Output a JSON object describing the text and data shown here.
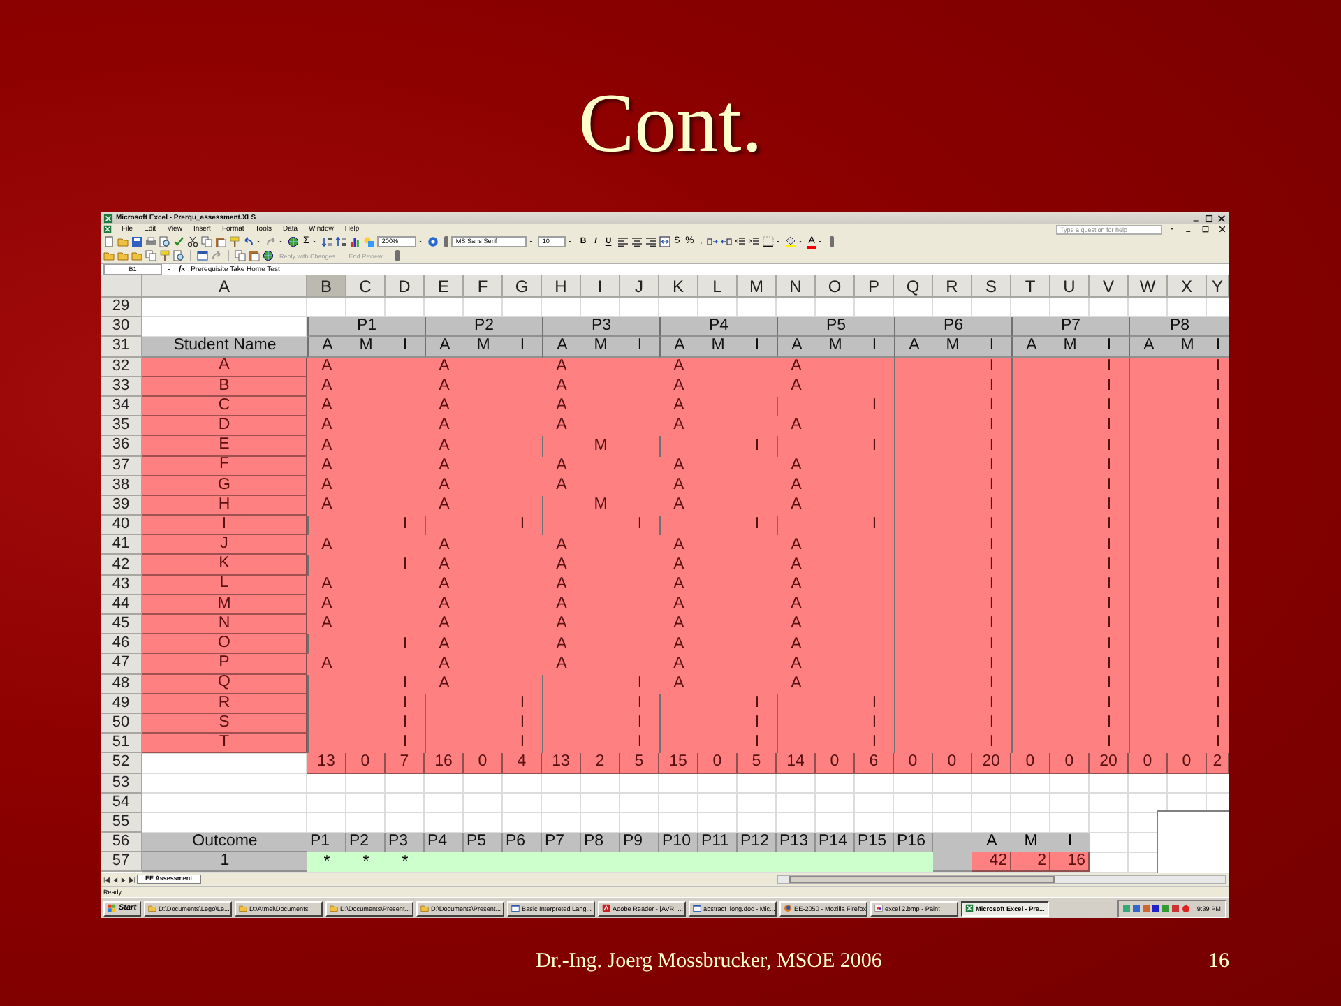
{
  "slide": {
    "title": "Cont.",
    "footer": "Dr.-Ing. Joerg Mossbrucker, MSOE 2006",
    "page_number": "16"
  },
  "excel": {
    "title": "Microsoft Excel - Prerqu_assessment.XLS",
    "menu": [
      "File",
      "Edit",
      "View",
      "Insert",
      "Format",
      "Tools",
      "Data",
      "Window",
      "Help"
    ],
    "help_placeholder": "Type a question for help",
    "toolbar": {
      "autosum": "Σ",
      "zoom": "200%",
      "font": "MS Sans Serif",
      "font_size": "10",
      "format_buttons": [
        "B",
        "I",
        "U"
      ],
      "number_buttons": [
        "$",
        "%",
        ","
      ],
      "font_color_button": "A",
      "review_buttons": [
        "Reply with Changes...",
        "End Review..."
      ]
    },
    "formula_bar": {
      "name_box": "B1",
      "function_label": "fx",
      "content": "Prerequisite Take Home Test"
    },
    "sheet": {
      "columns": [
        {
          "label": "A",
          "selected": false
        },
        {
          "label": "B",
          "selected": true
        },
        {
          "label": "C",
          "selected": false
        },
        {
          "label": "D",
          "selected": false
        },
        {
          "label": "E",
          "selected": false
        },
        {
          "label": "F",
          "selected": false
        },
        {
          "label": "G",
          "selected": false
        },
        {
          "label": "H",
          "selected": false
        },
        {
          "label": "I",
          "selected": false
        },
        {
          "label": "J",
          "selected": false
        },
        {
          "label": "K",
          "selected": false
        },
        {
          "label": "L",
          "selected": false
        },
        {
          "label": "M",
          "selected": false
        },
        {
          "label": "N",
          "selected": false
        },
        {
          "label": "O",
          "selected": false
        },
        {
          "label": "P",
          "selected": false
        },
        {
          "label": "Q",
          "selected": false
        },
        {
          "label": "R",
          "selected": false
        },
        {
          "label": "S",
          "selected": false
        },
        {
          "label": "T",
          "selected": false
        },
        {
          "label": "U",
          "selected": false
        },
        {
          "label": "V",
          "selected": false
        },
        {
          "label": "W",
          "selected": false
        },
        {
          "label": "X",
          "selected": false
        },
        {
          "label": "Y",
          "selected": false
        }
      ],
      "rows": [
        {
          "number": "29",
          "kind": "blank"
        },
        {
          "number": "30",
          "kind": "group_header",
          "groups": [
            "P1",
            "P2",
            "P3",
            "P4",
            "P5",
            "P6",
            "P7",
            "P8"
          ]
        },
        {
          "number": "31",
          "kind": "sub_header",
          "name": "Student Name",
          "cells": [
            "A",
            "M",
            "I",
            "A",
            "M",
            "I",
            "A",
            "M",
            "I",
            "A",
            "M",
            "I",
            "A",
            "M",
            "I",
            "A",
            "M",
            "I",
            "A",
            "M",
            "I",
            "A",
            "M",
            "I"
          ]
        },
        {
          "number": "32",
          "kind": "student",
          "name": "A",
          "grades": [
            {
              "kind": "a",
              "text": "A"
            },
            {
              "kind": "a",
              "text": "A"
            },
            {
              "kind": "a",
              "text": "A"
            },
            {
              "kind": "a",
              "text": "A"
            },
            {
              "kind": "a",
              "text": "A"
            },
            {
              "kind": "i",
              "text": "I"
            },
            {
              "kind": "i",
              "text": "I"
            },
            {
              "kind": "i",
              "text": "I"
            }
          ]
        },
        {
          "number": "33",
          "kind": "student",
          "name": "B",
          "grades": [
            {
              "kind": "a",
              "text": "A"
            },
            {
              "kind": "a",
              "text": "A"
            },
            {
              "kind": "a",
              "text": "A"
            },
            {
              "kind": "a",
              "text": "A"
            },
            {
              "kind": "a",
              "text": "A"
            },
            {
              "kind": "i",
              "text": "I"
            },
            {
              "kind": "i",
              "text": "I"
            },
            {
              "kind": "i",
              "text": "I"
            }
          ]
        },
        {
          "number": "34",
          "kind": "student",
          "name": "C",
          "grades": [
            {
              "kind": "a",
              "text": "A"
            },
            {
              "kind": "a",
              "text": "A"
            },
            {
              "kind": "a",
              "text": "A"
            },
            {
              "kind": "a",
              "text": "A"
            },
            {
              "kind": "i",
              "text": "I"
            },
            {
              "kind": "i",
              "text": "I"
            },
            {
              "kind": "i",
              "text": "I"
            },
            {
              "kind": "i",
              "text": "I"
            }
          ]
        },
        {
          "number": "35",
          "kind": "student",
          "name": "D",
          "grades": [
            {
              "kind": "a",
              "text": "A"
            },
            {
              "kind": "a",
              "text": "A"
            },
            {
              "kind": "a",
              "text": "A"
            },
            {
              "kind": "a",
              "text": "A"
            },
            {
              "kind": "a",
              "text": "A"
            },
            {
              "kind": "i",
              "text": "I"
            },
            {
              "kind": "i",
              "text": "I"
            },
            {
              "kind": "i",
              "text": "I"
            }
          ]
        },
        {
          "number": "36",
          "kind": "student",
          "name": "E",
          "grades": [
            {
              "kind": "a",
              "text": "A"
            },
            {
              "kind": "a",
              "text": "A"
            },
            {
              "kind": "m",
              "text": "M"
            },
            {
              "kind": "i",
              "text": "I"
            },
            {
              "kind": "i",
              "text": "I"
            },
            {
              "kind": "i",
              "text": "I"
            },
            {
              "kind": "i",
              "text": "I"
            },
            {
              "kind": "i",
              "text": "I"
            }
          ]
        },
        {
          "number": "37",
          "kind": "student",
          "name": "F",
          "grades": [
            {
              "kind": "a",
              "text": "A"
            },
            {
              "kind": "a",
              "text": "A"
            },
            {
              "kind": "a",
              "text": "A"
            },
            {
              "kind": "a",
              "text": "A"
            },
            {
              "kind": "a",
              "text": "A"
            },
            {
              "kind": "i",
              "text": "I"
            },
            {
              "kind": "i",
              "text": "I"
            },
            {
              "kind": "i",
              "text": "I"
            }
          ]
        },
        {
          "number": "38",
          "kind": "student",
          "name": "G",
          "grades": [
            {
              "kind": "a",
              "text": "A"
            },
            {
              "kind": "a",
              "text": "A"
            },
            {
              "kind": "a",
              "text": "A"
            },
            {
              "kind": "a",
              "text": "A"
            },
            {
              "kind": "a",
              "text": "A"
            },
            {
              "kind": "i",
              "text": "I"
            },
            {
              "kind": "i",
              "text": "I"
            },
            {
              "kind": "i",
              "text": "I"
            }
          ]
        },
        {
          "number": "39",
          "kind": "student",
          "name": "H",
          "grades": [
            {
              "kind": "a",
              "text": "A"
            },
            {
              "kind": "a",
              "text": "A"
            },
            {
              "kind": "m",
              "text": "M"
            },
            {
              "kind": "a",
              "text": "A"
            },
            {
              "kind": "a",
              "text": "A"
            },
            {
              "kind": "i",
              "text": "I"
            },
            {
              "kind": "i",
              "text": "I"
            },
            {
              "kind": "i",
              "text": "I"
            }
          ]
        },
        {
          "number": "40",
          "kind": "student",
          "name": "I",
          "grades": [
            {
              "kind": "i",
              "text": "I"
            },
            {
              "kind": "i",
              "text": "I"
            },
            {
              "kind": "i",
              "text": "I"
            },
            {
              "kind": "i",
              "text": "I"
            },
            {
              "kind": "i",
              "text": "I"
            },
            {
              "kind": "i",
              "text": "I"
            },
            {
              "kind": "i",
              "text": "I"
            },
            {
              "kind": "i",
              "text": "I"
            }
          ]
        },
        {
          "number": "41",
          "kind": "student",
          "name": "J",
          "grades": [
            {
              "kind": "a",
              "text": "A"
            },
            {
              "kind": "a",
              "text": "A"
            },
            {
              "kind": "a",
              "text": "A"
            },
            {
              "kind": "a",
              "text": "A"
            },
            {
              "kind": "a",
              "text": "A"
            },
            {
              "kind": "i",
              "text": "I"
            },
            {
              "kind": "i",
              "text": "I"
            },
            {
              "kind": "i",
              "text": "I"
            }
          ]
        },
        {
          "number": "42",
          "kind": "student",
          "name": "K",
          "grades": [
            {
              "kind": "i",
              "text": "I"
            },
            {
              "kind": "a",
              "text": "A"
            },
            {
              "kind": "a",
              "text": "A"
            },
            {
              "kind": "a",
              "text": "A"
            },
            {
              "kind": "a",
              "text": "A"
            },
            {
              "kind": "i",
              "text": "I"
            },
            {
              "kind": "i",
              "text": "I"
            },
            {
              "kind": "i",
              "text": "I"
            }
          ]
        },
        {
          "number": "43",
          "kind": "student",
          "name": "L",
          "grades": [
            {
              "kind": "a",
              "text": "A"
            },
            {
              "kind": "a",
              "text": "A"
            },
            {
              "kind": "a",
              "text": "A"
            },
            {
              "kind": "a",
              "text": "A"
            },
            {
              "kind": "a",
              "text": "A"
            },
            {
              "kind": "i",
              "text": "I"
            },
            {
              "kind": "i",
              "text": "I"
            },
            {
              "kind": "i",
              "text": "I"
            }
          ]
        },
        {
          "number": "44",
          "kind": "student",
          "name": "M",
          "grades": [
            {
              "kind": "a",
              "text": "A"
            },
            {
              "kind": "a",
              "text": "A"
            },
            {
              "kind": "a",
              "text": "A"
            },
            {
              "kind": "a",
              "text": "A"
            },
            {
              "kind": "a",
              "text": "A"
            },
            {
              "kind": "i",
              "text": "I"
            },
            {
              "kind": "i",
              "text": "I"
            },
            {
              "kind": "i",
              "text": "I"
            }
          ]
        },
        {
          "number": "45",
          "kind": "student",
          "name": "N",
          "grades": [
            {
              "kind": "a",
              "text": "A"
            },
            {
              "kind": "a",
              "text": "A"
            },
            {
              "kind": "a",
              "text": "A"
            },
            {
              "kind": "a",
              "text": "A"
            },
            {
              "kind": "a",
              "text": "A"
            },
            {
              "kind": "i",
              "text": "I"
            },
            {
              "kind": "i",
              "text": "I"
            },
            {
              "kind": "i",
              "text": "I"
            }
          ]
        },
        {
          "number": "46",
          "kind": "student",
          "name": "O",
          "grades": [
            {
              "kind": "i",
              "text": "I"
            },
            {
              "kind": "a",
              "text": "A"
            },
            {
              "kind": "a",
              "text": "A"
            },
            {
              "kind": "a",
              "text": "A"
            },
            {
              "kind": "a",
              "text": "A"
            },
            {
              "kind": "i",
              "text": "I"
            },
            {
              "kind": "i",
              "text": "I"
            },
            {
              "kind": "i",
              "text": "I"
            }
          ]
        },
        {
          "number": "47",
          "kind": "student",
          "name": "P",
          "grades": [
            {
              "kind": "a",
              "text": "A"
            },
            {
              "kind": "a",
              "text": "A"
            },
            {
              "kind": "a",
              "text": "A"
            },
            {
              "kind": "a",
              "text": "A"
            },
            {
              "kind": "a",
              "text": "A"
            },
            {
              "kind": "i",
              "text": "I"
            },
            {
              "kind": "i",
              "text": "I"
            },
            {
              "kind": "i",
              "text": "I"
            }
          ]
        },
        {
          "number": "48",
          "kind": "student",
          "name": "Q",
          "grades": [
            {
              "kind": "i",
              "text": "I"
            },
            {
              "kind": "a",
              "text": "A"
            },
            {
              "kind": "i",
              "text": "I"
            },
            {
              "kind": "a",
              "text": "A"
            },
            {
              "kind": "a",
              "text": "A"
            },
            {
              "kind": "i",
              "text": "I"
            },
            {
              "kind": "i",
              "text": "I"
            },
            {
              "kind": "i",
              "text": "I"
            }
          ]
        },
        {
          "number": "49",
          "kind": "student",
          "name": "R",
          "grades": [
            {
              "kind": "i",
              "text": "I"
            },
            {
              "kind": "i",
              "text": "I"
            },
            {
              "kind": "i",
              "text": "I"
            },
            {
              "kind": "i",
              "text": "I"
            },
            {
              "kind": "i",
              "text": "I"
            },
            {
              "kind": "i",
              "text": "I"
            },
            {
              "kind": "i",
              "text": "I"
            },
            {
              "kind": "i",
              "text": "I"
            }
          ]
        },
        {
          "number": "50",
          "kind": "student",
          "name": "S",
          "grades": [
            {
              "kind": "i",
              "text": "I"
            },
            {
              "kind": "i",
              "text": "I"
            },
            {
              "kind": "i",
              "text": "I"
            },
            {
              "kind": "i",
              "text": "I"
            },
            {
              "kind": "i",
              "text": "I"
            },
            {
              "kind": "i",
              "text": "I"
            },
            {
              "kind": "i",
              "text": "I"
            },
            {
              "kind": "i",
              "text": "I"
            }
          ]
        },
        {
          "number": "51",
          "kind": "student",
          "name": "T",
          "grades": [
            {
              "kind": "i",
              "text": "I"
            },
            {
              "kind": "i",
              "text": "I"
            },
            {
              "kind": "i",
              "text": "I"
            },
            {
              "kind": "i",
              "text": "I"
            },
            {
              "kind": "i",
              "text": "I"
            },
            {
              "kind": "i",
              "text": "I"
            },
            {
              "kind": "i",
              "text": "I"
            },
            {
              "kind": "i",
              "text": "I"
            }
          ]
        },
        {
          "number": "52",
          "kind": "totals",
          "cells": [
            "13",
            "0",
            "7",
            "16",
            "0",
            "4",
            "13",
            "2",
            "5",
            "15",
            "0",
            "5",
            "14",
            "0",
            "6",
            "0",
            "0",
            "20",
            "0",
            "0",
            "20",
            "0",
            "0",
            "2"
          ]
        },
        {
          "number": "53",
          "kind": "blank"
        },
        {
          "number": "54",
          "kind": "blank"
        },
        {
          "number": "55",
          "kind": "blank"
        },
        {
          "number": "56",
          "kind": "outcome_header",
          "name": "Outcome",
          "outcomes": [
            "P1",
            "P2",
            "P3",
            "P4",
            "P5",
            "P6",
            "P7",
            "P8",
            "P9",
            "P10",
            "P11",
            "P12",
            "P13",
            "P14",
            "P15",
            "P16"
          ],
          "summary": [
            "A",
            "M",
            "I"
          ]
        },
        {
          "number": "57",
          "kind": "outcome_row",
          "name": "1",
          "marks": [
            "*",
            "*",
            "*"
          ],
          "summary": [
            "42",
            "2",
            "16"
          ]
        }
      ]
    },
    "sheet_tabs": [
      {
        "label": "EE Assessment",
        "selected": true
      }
    ],
    "status": "Ready",
    "taskbar": {
      "start": "Start",
      "items": [
        {
          "label": "D:\\Documents\\Lego\\Le...",
          "kind": "folder",
          "selected": false
        },
        {
          "label": "D:\\Atmel\\Documents",
          "kind": "folder",
          "selected": false
        },
        {
          "label": "D:\\Documents\\Present...",
          "kind": "folder",
          "selected": false
        },
        {
          "label": "D:\\Documents\\Present...",
          "kind": "folder",
          "selected": false
        },
        {
          "label": "Basic Interpreted Lang...",
          "kind": "app",
          "selected": false
        },
        {
          "label": "Adobe Reader - [AVR_...",
          "kind": "reader",
          "selected": false
        },
        {
          "label": "abstract_long.doc - Mic...",
          "kind": "app",
          "selected": false
        },
        {
          "label": "EE-2050 - Mozilla Firefox",
          "kind": "browser",
          "selected": false
        },
        {
          "label": "excel 2.bmp - Paint",
          "kind": "paint",
          "selected": false
        },
        {
          "label": "Microsoft Excel - Pre...",
          "kind": "excel",
          "selected": true
        }
      ],
      "clock": "9:39 PM"
    }
  }
}
